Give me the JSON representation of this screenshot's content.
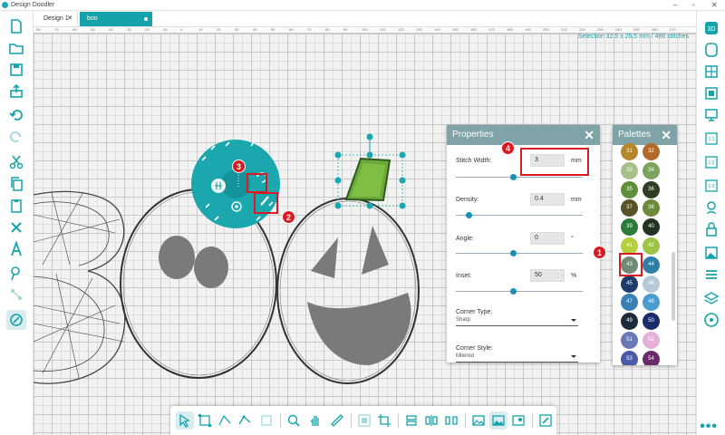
{
  "app": {
    "title": "Design Doodler"
  },
  "tabs": [
    {
      "label": "Design 1"
    },
    {
      "label": "boo"
    }
  ],
  "ruler_ticks": [
    "-80",
    "-70",
    "-60",
    "-50",
    "-40",
    "-30",
    "-20",
    "-10",
    "0",
    "10",
    "20",
    "30",
    "40",
    "50",
    "60",
    "70",
    "80",
    "90",
    "100",
    "110",
    "120",
    "130",
    "140",
    "150",
    "160",
    "170",
    "180",
    "190",
    "200",
    "210",
    "220",
    "230",
    "240",
    "250",
    "260",
    "270"
  ],
  "selection_info": "Selection   32.5 x 26.5 mm / 496 stitches",
  "properties": {
    "title": "Properties",
    "stitch_width": {
      "label": "Stitch Width:",
      "value": "3",
      "unit": "mm",
      "slider": 0.45
    },
    "density": {
      "label": "Density:",
      "value": "0.4",
      "unit": "mm",
      "slider": 0.1
    },
    "angle": {
      "label": "Angle:",
      "value": "0",
      "unit": "°",
      "slider": 0.45
    },
    "inset": {
      "label": "Inset:",
      "value": "50",
      "unit": "%",
      "slider": 0.45
    },
    "corner_type": {
      "label": "Corner Type:",
      "value": "Sharp"
    },
    "corner_style": {
      "label": "Corner Style:",
      "value": "Mitered"
    }
  },
  "palettes": {
    "title": "Palettes",
    "swatches": [
      {
        "num": "31",
        "color": "#b5862a"
      },
      {
        "num": "32",
        "color": "#b3692a"
      },
      {
        "num": "33",
        "color": "#a6c08a"
      },
      {
        "num": "34",
        "color": "#7aa35c"
      },
      {
        "num": "35",
        "color": "#5d8f3a"
      },
      {
        "num": "36",
        "color": "#2f3d22"
      },
      {
        "num": "37",
        "color": "#5a5226"
      },
      {
        "num": "38",
        "color": "#6b8a3a"
      },
      {
        "num": "39",
        "color": "#2e7a3a"
      },
      {
        "num": "40",
        "color": "#223322"
      },
      {
        "num": "41",
        "color": "#b5cf3a"
      },
      {
        "num": "42",
        "color": "#9cc446"
      },
      {
        "num": "43",
        "color": "#6e8a74"
      },
      {
        "num": "44",
        "color": "#2e7fa8"
      },
      {
        "num": "45",
        "color": "#1d3b6b"
      },
      {
        "num": "46",
        "color": "#b7c9d6"
      },
      {
        "num": "47",
        "color": "#3a7fb3"
      },
      {
        "num": "48",
        "color": "#4a9bd0"
      },
      {
        "num": "49",
        "color": "#1d2a3a"
      },
      {
        "num": "50",
        "color": "#1a2a6a"
      },
      {
        "num": "51",
        "color": "#6a78b8"
      },
      {
        "num": "52",
        "color": "#e4b0d8"
      },
      {
        "num": "53",
        "color": "#4a5aa8"
      },
      {
        "num": "54",
        "color": "#6a2a6a"
      }
    ]
  },
  "callouts": [
    "1",
    "2",
    "3",
    "4"
  ],
  "more": "•••"
}
